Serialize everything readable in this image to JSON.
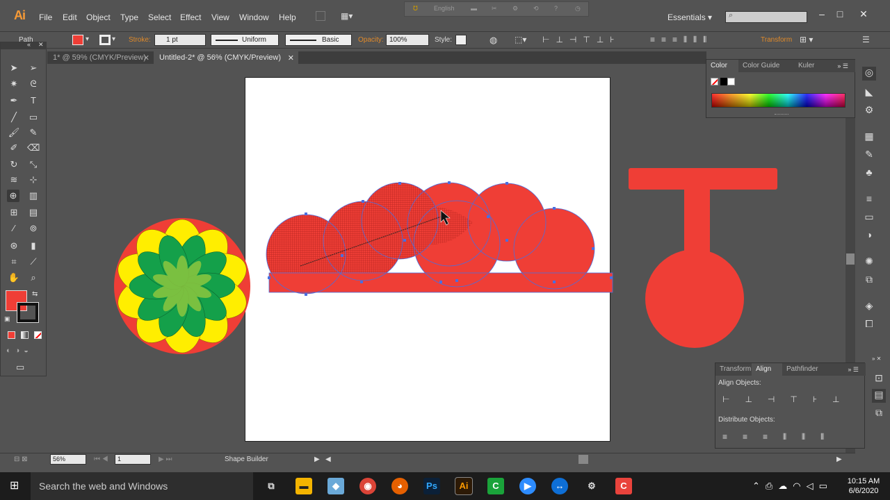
{
  "app": {
    "logo": "Ai"
  },
  "menu": [
    "File",
    "Edit",
    "Object",
    "Type",
    "Select",
    "Effect",
    "View",
    "Window",
    "Help"
  ],
  "workspace": "Essentials",
  "lang_bar": {
    "language": "English"
  },
  "control_bar": {
    "selection_type": "Path",
    "stroke_label": "Stroke:",
    "stroke_weight": "1 pt",
    "profile": "Uniform",
    "brush": "Basic",
    "opacity_label": "Opacity:",
    "opacity_value": "100%",
    "style_label": "Style:",
    "transform_label": "Transform",
    "fill_color": "#ef3e36"
  },
  "doc_tabs": [
    {
      "label": "1* @ 59% (CMYK/Preview)",
      "active": false
    },
    {
      "label": "Untitled-2* @ 56% (CMYK/Preview)",
      "active": true
    }
  ],
  "color_panel": {
    "tabs": [
      "Color",
      "Color Guide",
      "Kuler"
    ]
  },
  "align_panel": {
    "tabs": [
      "Transform",
      "Align",
      "Pathfinder"
    ],
    "align_objects_label": "Align Objects:",
    "distribute_objects_label": "Distribute Objects:"
  },
  "status_bar": {
    "zoom": "56%",
    "page": "1",
    "tool_name": "Shape Builder"
  },
  "taskbar": {
    "search_placeholder": "Search the web and Windows",
    "time": "10:15 AM",
    "date": "6/6/2020"
  },
  "art_colors": {
    "red": "#ef3e36",
    "yellow": "#ffee00",
    "green": "#14a04a",
    "light_green": "#8cc63f"
  }
}
